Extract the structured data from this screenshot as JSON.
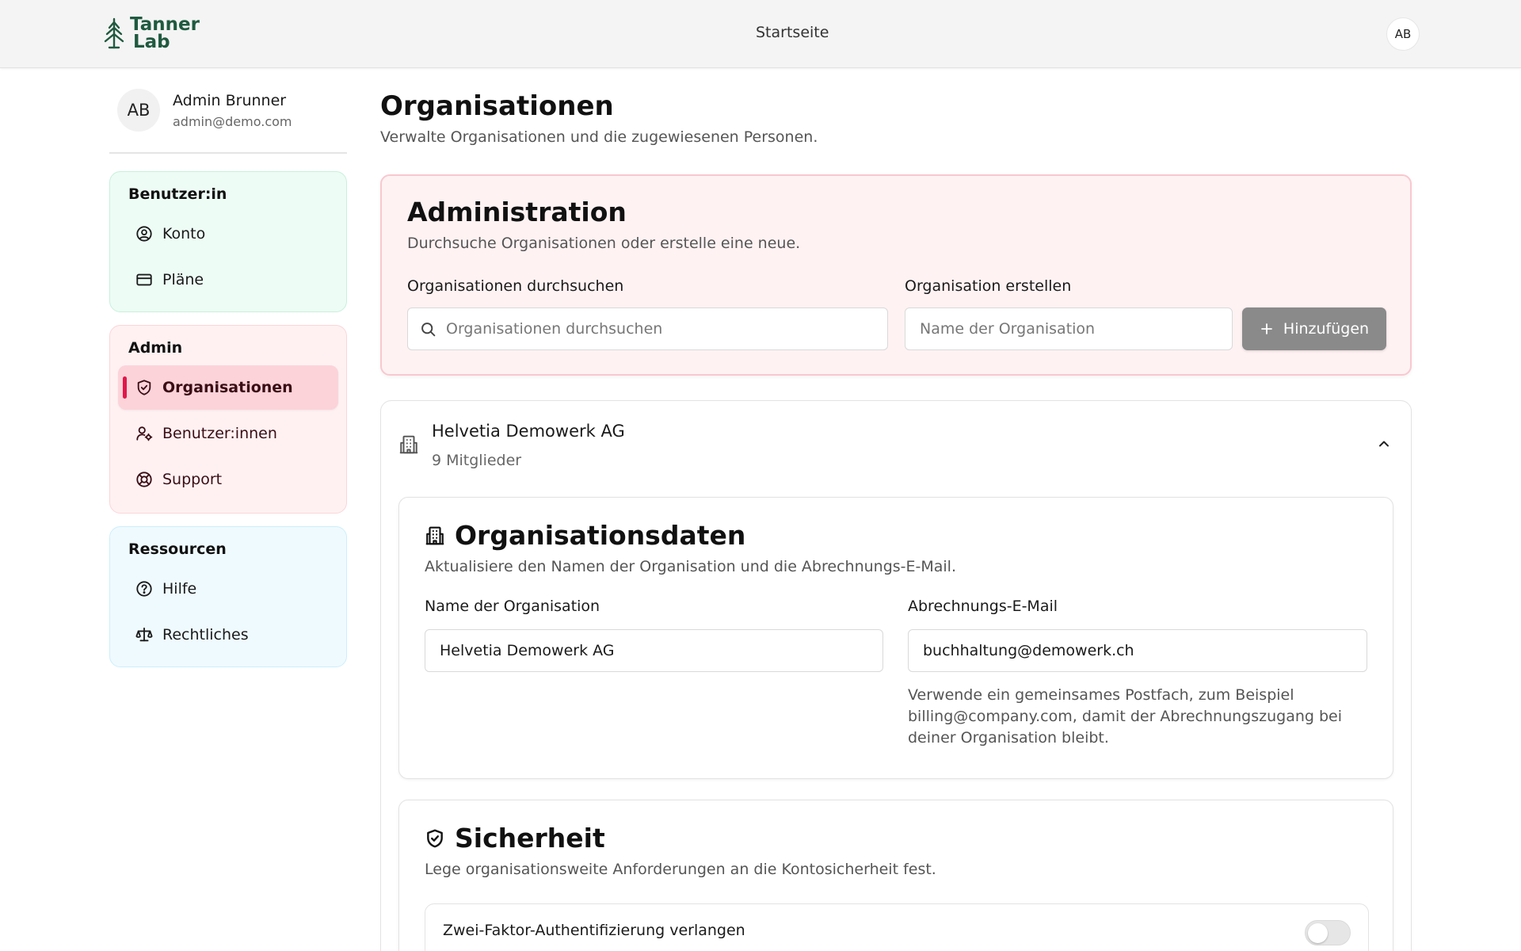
{
  "app": {
    "logo_line1": "Tanner",
    "logo_line2": "Lab",
    "nav_home": "Startseite",
    "user_initials": "AB"
  },
  "sidebar": {
    "profile": {
      "initials": "AB",
      "name": "Admin Brunner",
      "email": "admin@demo.com"
    },
    "groups": [
      {
        "title": "Benutzer:in",
        "items": [
          {
            "label": "Konto",
            "icon": "user-circle-icon"
          },
          {
            "label": "Pläne",
            "icon": "credit-card-icon"
          }
        ]
      },
      {
        "title": "Admin",
        "items": [
          {
            "label": "Organisationen",
            "icon": "shield-check-icon",
            "active": true
          },
          {
            "label": "Benutzer:innen",
            "icon": "users-gear-icon"
          },
          {
            "label": "Support",
            "icon": "life-buoy-icon"
          }
        ]
      },
      {
        "title": "Ressourcen",
        "items": [
          {
            "label": "Hilfe",
            "icon": "help-circle-icon"
          },
          {
            "label": "Rechtliches",
            "icon": "scale-icon"
          }
        ]
      }
    ]
  },
  "main": {
    "title": "Organisationen",
    "subtitle": "Verwalte Organisationen und die zugewiesenen Personen.",
    "admin_card": {
      "title": "Administration",
      "description": "Durchsuche Organisationen oder erstelle eine neue.",
      "search_label": "Organisationen durchsuchen",
      "search_placeholder": "Organisationen durchsuchen",
      "create_label": "Organisation erstellen",
      "create_placeholder": "Name der Organisation",
      "add_button": "Hinzufügen"
    },
    "organization": {
      "name": "Helvetia Demowerk AG",
      "members": "9 Mitglieder",
      "expanded": true,
      "data_card": {
        "title": "Organisationsdaten",
        "description": "Aktualisiere den Namen der Organisation und die Abrechnungs-E-Mail.",
        "name_label": "Name der Organisation",
        "name_value": "Helvetia Demowerk AG",
        "email_label": "Abrechnungs-E-Mail",
        "email_value": "buchhaltung@demowerk.ch",
        "email_hint": "Verwende ein gemeinsames Postfach, zum Beispiel billing@company.com, damit der Abrechnungszugang bei deiner Organisation bleibt."
      },
      "security_card": {
        "title": "Sicherheit",
        "description": "Lege organisationsweite Anforderungen an die Kontosicherheit fest.",
        "mfa_title": "Zwei-Faktor-Authentifizierung verlangen",
        "mfa_enabled": false
      }
    }
  },
  "colors": {
    "brand": "#1f5a3f",
    "accent": "#e0174a",
    "user_group_bg": "#edfcf5",
    "admin_group_bg": "#fff1f2",
    "resources_group_bg": "#effaff"
  }
}
